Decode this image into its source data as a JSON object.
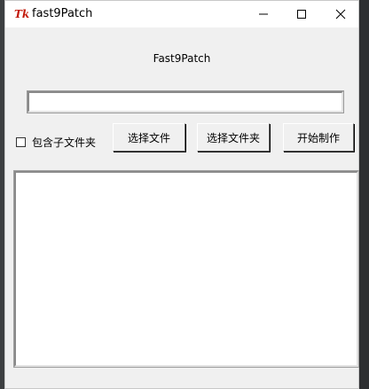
{
  "window": {
    "title": "fast9Patch",
    "icon_text": "Tk",
    "controls": {
      "minimize": "minimize-icon",
      "maximize": "maximize-icon",
      "close": "close-icon"
    }
  },
  "main": {
    "heading": "Fast9Patch",
    "path_input_value": "",
    "include_subfolders": {
      "label": "包含子文件夹",
      "checked": false
    },
    "buttons": {
      "select_file": "选择文件",
      "select_folder": "选择文件夹",
      "start": "开始制作"
    },
    "log_text": ""
  },
  "colors": {
    "window_bg": "#f0f0f0",
    "titlebar_bg": "#ffffff",
    "tk_icon": "#c21807"
  }
}
